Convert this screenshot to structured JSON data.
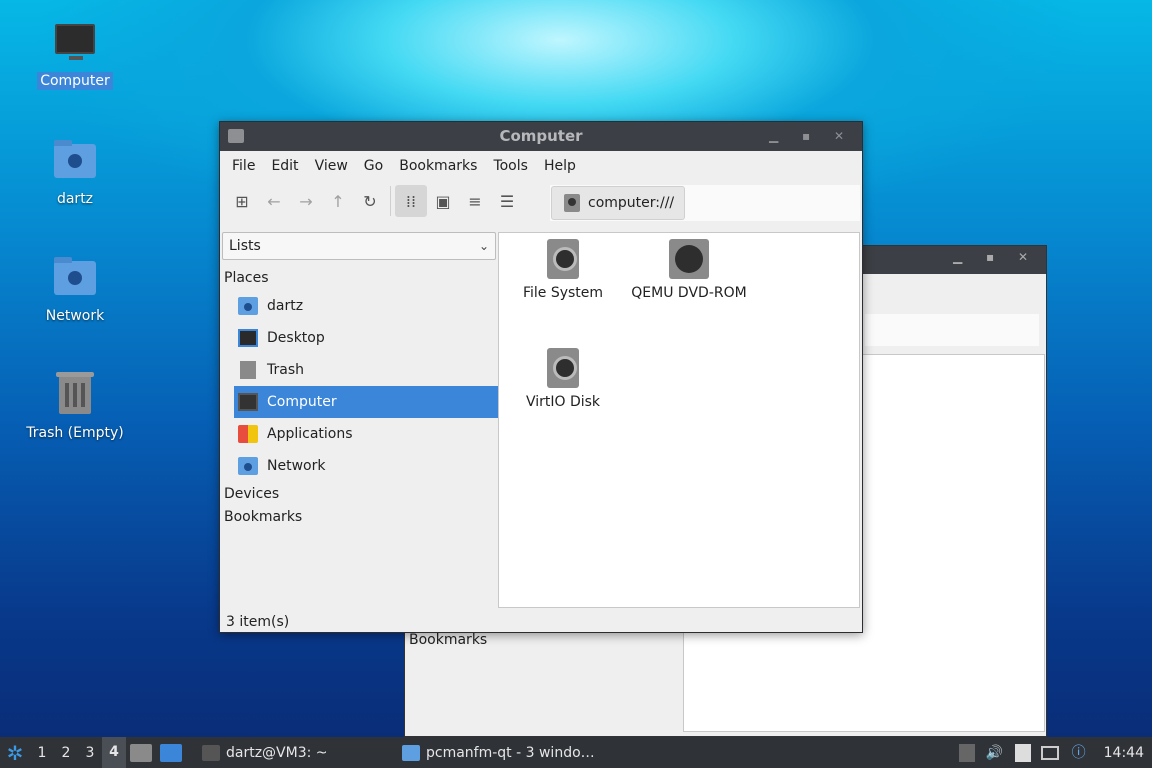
{
  "desktop": {
    "icons": [
      {
        "label": "Computer"
      },
      {
        "label": "dartz"
      },
      {
        "label": "Network"
      },
      {
        "label": "Trash (Empty)"
      }
    ]
  },
  "background_window": {
    "bookmarks_label": "Bookmarks"
  },
  "window": {
    "title": "Computer",
    "menu": [
      "File",
      "Edit",
      "View",
      "Go",
      "Bookmarks",
      "Tools",
      "Help"
    ],
    "toolbar": {
      "icons": [
        "new-tab-icon",
        "back-icon",
        "forward-icon",
        "up-icon",
        "reload-icon",
        "icon-view-icon",
        "thumbnail-view-icon",
        "compact-view-icon",
        "detailed-list-icon"
      ]
    },
    "path": "computer:///",
    "side_pane": {
      "mode": "Lists",
      "places_header": "Places",
      "places": [
        {
          "label": "dartz",
          "icon": "home-folder-icon"
        },
        {
          "label": "Desktop",
          "icon": "desktop-icon"
        },
        {
          "label": "Trash",
          "icon": "trash-icon"
        },
        {
          "label": "Computer",
          "icon": "computer-icon",
          "selected": true
        },
        {
          "label": "Applications",
          "icon": "applications-icon"
        },
        {
          "label": "Network",
          "icon": "network-folder-icon"
        }
      ],
      "devices_header": "Devices",
      "bookmarks_header": "Bookmarks"
    },
    "files": [
      {
        "label": "File System",
        "icon": "drive-harddisk-icon"
      },
      {
        "label": "QEMU DVD-ROM",
        "icon": "drive-optical-icon"
      },
      {
        "label": "VirtIO Disk",
        "icon": "drive-harddisk-icon"
      }
    ],
    "status": "3 item(s)"
  },
  "taskbar": {
    "workspaces": [
      "1",
      "2",
      "3",
      "4"
    ],
    "current_workspace": "4",
    "tasks": [
      {
        "label": "dartz@VM3: ~",
        "icon": "terminal-icon"
      },
      {
        "label": "pcmanfm-qt - 3 windo…",
        "icon": "folder-icon"
      }
    ],
    "clock": "14:44"
  }
}
